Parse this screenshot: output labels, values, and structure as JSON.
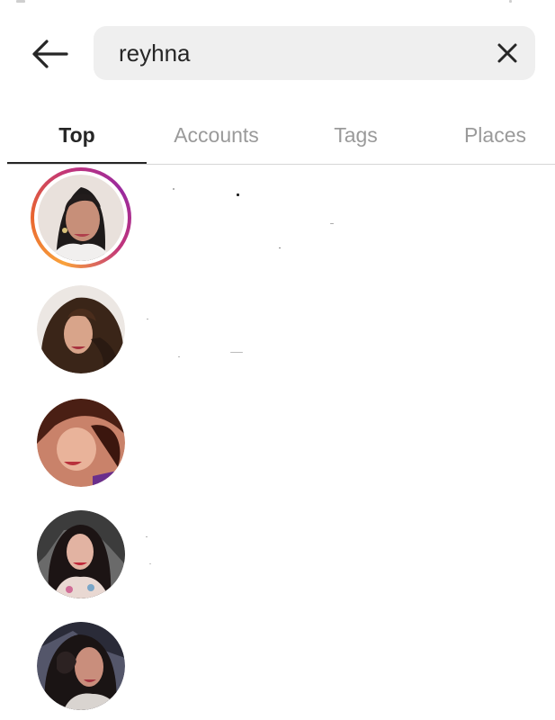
{
  "search": {
    "query": "reyhna",
    "back_icon": "arrow-left-icon",
    "clear_icon": "close-icon"
  },
  "tabs": [
    {
      "label": "Top",
      "active": true
    },
    {
      "label": "Accounts",
      "active": false
    },
    {
      "label": "Tags",
      "active": false
    },
    {
      "label": "Places",
      "active": false
    }
  ],
  "results": [
    {
      "avatar_icon": "profile-photo",
      "has_story": true
    },
    {
      "avatar_icon": "profile-photo",
      "has_story": false
    },
    {
      "avatar_icon": "profile-photo",
      "has_story": false
    },
    {
      "avatar_icon": "profile-photo",
      "has_story": false
    },
    {
      "avatar_icon": "profile-photo",
      "has_story": false
    }
  ],
  "colors": {
    "search_bg": "#efefef",
    "active_tab": "#262626",
    "inactive_tab": "#9a9a9a",
    "story_ring_start": "#f9a23b",
    "story_ring_end": "#9a2a9e"
  }
}
